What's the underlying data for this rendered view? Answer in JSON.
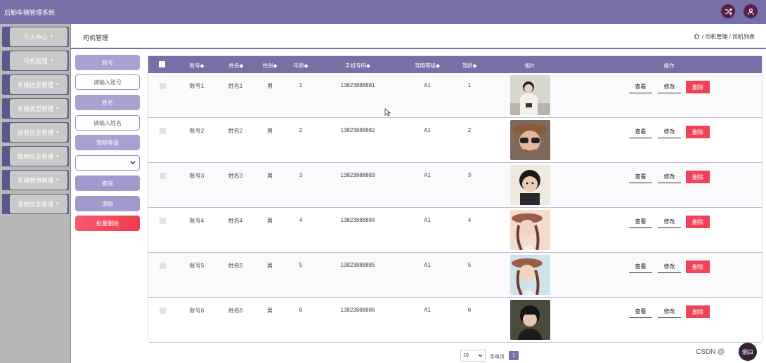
{
  "app": {
    "title": "后勤车辆管理系统"
  },
  "top_icons": [
    {
      "name": "shuffle-icon"
    },
    {
      "name": "user-icon"
    }
  ],
  "sidebar": {
    "items": [
      {
        "label": "个人中心"
      },
      {
        "label": "司机管理"
      },
      {
        "label": "车辆信息管理"
      },
      {
        "label": "车辆类型管理"
      },
      {
        "label": "运营信息管理"
      },
      {
        "label": "维修信息管理"
      },
      {
        "label": "车辆费用管理"
      },
      {
        "label": "事故信息管理"
      }
    ]
  },
  "breadcrumb": {
    "title": "司机管理",
    "path": "/ 司机管理 / 司机列表"
  },
  "filters": {
    "account_label": "账号",
    "account_placeholder": "请输入账号",
    "name_label": "姓名",
    "name_placeholder": "请输入姓名",
    "license_label": "驾照等级",
    "search_label": "查询",
    "add_label": "添加",
    "batch_delete_label": "批量删除"
  },
  "table": {
    "columns": [
      "账号",
      "姓名",
      "性别",
      "年龄",
      "手机号码",
      "驾照等级",
      "驾龄",
      "相片",
      "操作"
    ],
    "sort_mark": "◆",
    "actions": {
      "view": "查看",
      "edit": "修改",
      "delete": "删除"
    },
    "rows": [
      {
        "account": "账号1",
        "name": "姓名1",
        "gender": "男",
        "age": "1",
        "phone": "13823888881",
        "license": "A1",
        "years": "1"
      },
      {
        "account": "账号2",
        "name": "姓名2",
        "gender": "男",
        "age": "2",
        "phone": "13823888882",
        "license": "A1",
        "years": "2"
      },
      {
        "account": "账号3",
        "name": "姓名3",
        "gender": "男",
        "age": "3",
        "phone": "13823888883",
        "license": "A1",
        "years": "3"
      },
      {
        "account": "账号4",
        "name": "姓名4",
        "gender": "男",
        "age": "4",
        "phone": "13823888884",
        "license": "A1",
        "years": "4"
      },
      {
        "account": "账号5",
        "name": "姓名5",
        "gender": "男",
        "age": "5",
        "phone": "13823888885",
        "license": "A1",
        "years": "5"
      },
      {
        "account": "账号6",
        "name": "姓名6",
        "gender": "男",
        "age": "6",
        "phone": "13823888886",
        "license": "A1",
        "years": "6"
      }
    ]
  },
  "pagination": {
    "page_size": "10",
    "per_page_label": "条每页",
    "current_page": "1"
  },
  "watermark": {
    "text": "CSDN @",
    "avatar_text": "烟白"
  },
  "colors": {
    "accent": "#7670a6",
    "danger": "#f0435a",
    "sidebar_bg": "#b8b8b8"
  }
}
